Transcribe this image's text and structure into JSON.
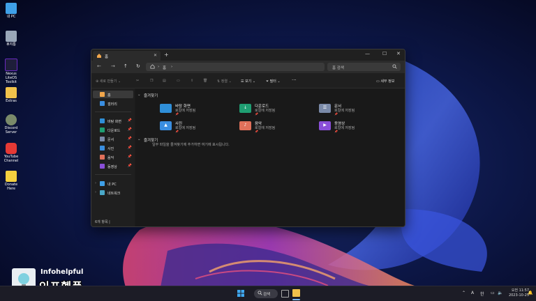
{
  "desktop": {
    "icons": [
      {
        "label": "내 PC",
        "icon": "monitor-icon",
        "color": "#3fa0e8"
      },
      {
        "label": "휴지통",
        "icon": "recycle-bin-icon",
        "color": "#9aa7b8"
      },
      {
        "label": "Nexus LiteOS Toolkit",
        "icon": "nexus-toolkit-icon",
        "color": "#6a2ac0"
      },
      {
        "label": "Extras",
        "icon": "folder-icon",
        "color": "#f1c24b"
      },
      {
        "label": "Discord Server",
        "icon": "discord-icon",
        "color": "#7a8a6a"
      },
      {
        "label": "YouTube Channel",
        "icon": "youtube-icon",
        "color": "#e53935"
      },
      {
        "label": "Donate Here",
        "icon": "donate-icon",
        "color": "#f4d03f"
      }
    ]
  },
  "window": {
    "tab_title": "홈",
    "breadcrumb": [
      "홈"
    ],
    "search_placeholder": "홈 검색",
    "toolbar": {
      "new_label": "새로 만들기",
      "sort_label": "정렬",
      "view_label": "보기",
      "filter_label": "필터",
      "more_label": "···",
      "details_label": "세부 정보"
    },
    "nav": {
      "home": "홈",
      "gallery": "갤러리",
      "pinned": [
        {
          "label": "바탕 화면",
          "icon": "desktop-folder-icon",
          "color": "#2f8fd8"
        },
        {
          "label": "다운로드",
          "icon": "downloads-folder-icon",
          "color": "#1f9e72"
        },
        {
          "label": "문서",
          "icon": "documents-folder-icon",
          "color": "#7a8aa8"
        },
        {
          "label": "사진",
          "icon": "pictures-folder-icon",
          "color": "#3a8ee0"
        },
        {
          "label": "음악",
          "icon": "music-folder-icon",
          "color": "#e0705a"
        },
        {
          "label": "동영상",
          "icon": "videos-folder-icon",
          "color": "#8a4fd8"
        }
      ],
      "this_pc": "내 PC",
      "network": "네트워크"
    },
    "status": "6개 항목 |",
    "quick_access": {
      "title": "즐겨찾기",
      "items": [
        {
          "name": "바탕 화면",
          "sub": "로컬에 저장됨",
          "color": "#2f8fd8",
          "glyph": ""
        },
        {
          "name": "다운로드",
          "sub": "로컬에 저장됨",
          "color": "#1f9e72",
          "glyph": "↓"
        },
        {
          "name": "문서",
          "sub": "로컬에 저장됨",
          "color": "#7a8aa8",
          "glyph": "☰"
        },
        {
          "name": "사진",
          "sub": "로컬에 저장됨",
          "color": "#3a8ee0",
          "glyph": "▲"
        },
        {
          "name": "음악",
          "sub": "로컬에 저장됨",
          "color": "#e0705a",
          "glyph": "♪"
        },
        {
          "name": "동영상",
          "sub": "로컬에 저장됨",
          "color": "#8a4fd8",
          "glyph": "▶"
        }
      ]
    },
    "favorites": {
      "title": "즐겨찾기",
      "empty_message": "일부 파일을 즐겨찾기에 추가하면 여기에 표시됩니다."
    }
  },
  "watermark": {
    "en": "Infohelpful",
    "ko": "인포헬풀"
  },
  "taskbar": {
    "search_label": "검색",
    "lang": "A",
    "ime": "한",
    "time": "오전 11:57",
    "date": "2023-10-25"
  }
}
